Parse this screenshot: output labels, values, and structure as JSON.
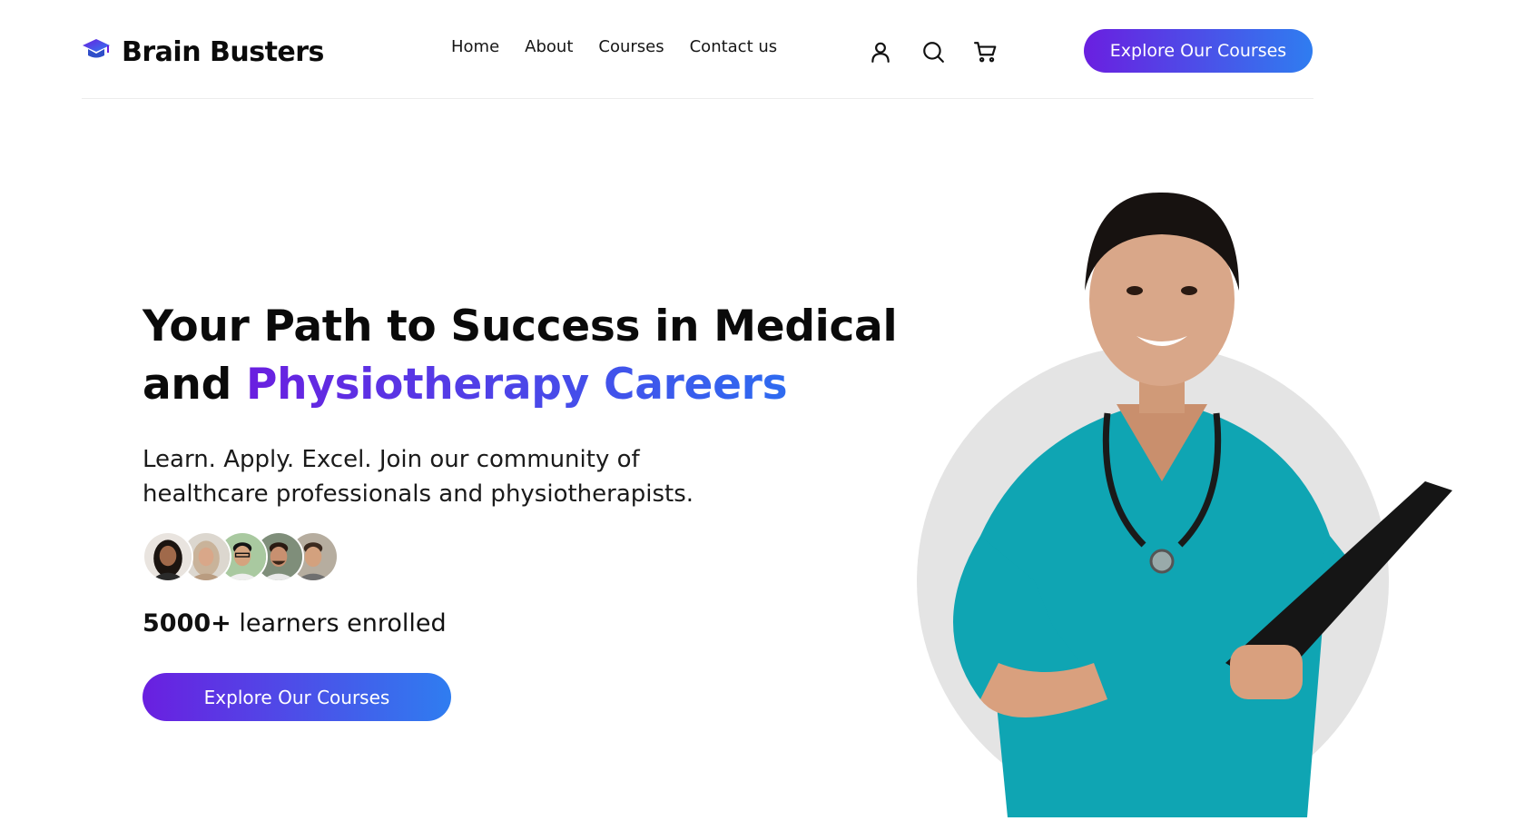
{
  "header": {
    "brand": "Brain Busters",
    "logo_icon": "graduation-cap-icon",
    "nav": [
      "Home",
      "About",
      "Courses",
      "Contact us"
    ],
    "icons": [
      "user-icon",
      "search-icon",
      "cart-icon"
    ],
    "cta": "Explore Our Courses"
  },
  "hero": {
    "title_line1": "Your Path to Success in Medical",
    "title_line2_prefix": "and ",
    "title_line2_accent": "Physiotherapy Careers",
    "subtitle": "Learn. Apply. Excel. Join our community of healthcare professionals and physiotherapists.",
    "learners_count": "5000+",
    "learners_text": " learners enrolled",
    "cta": "Explore Our Courses",
    "avatar_count": 5
  },
  "colors": {
    "gradient_start": "#6a1fe0",
    "gradient_end": "#2f7df0",
    "scrubs": "#0fa5b3"
  }
}
